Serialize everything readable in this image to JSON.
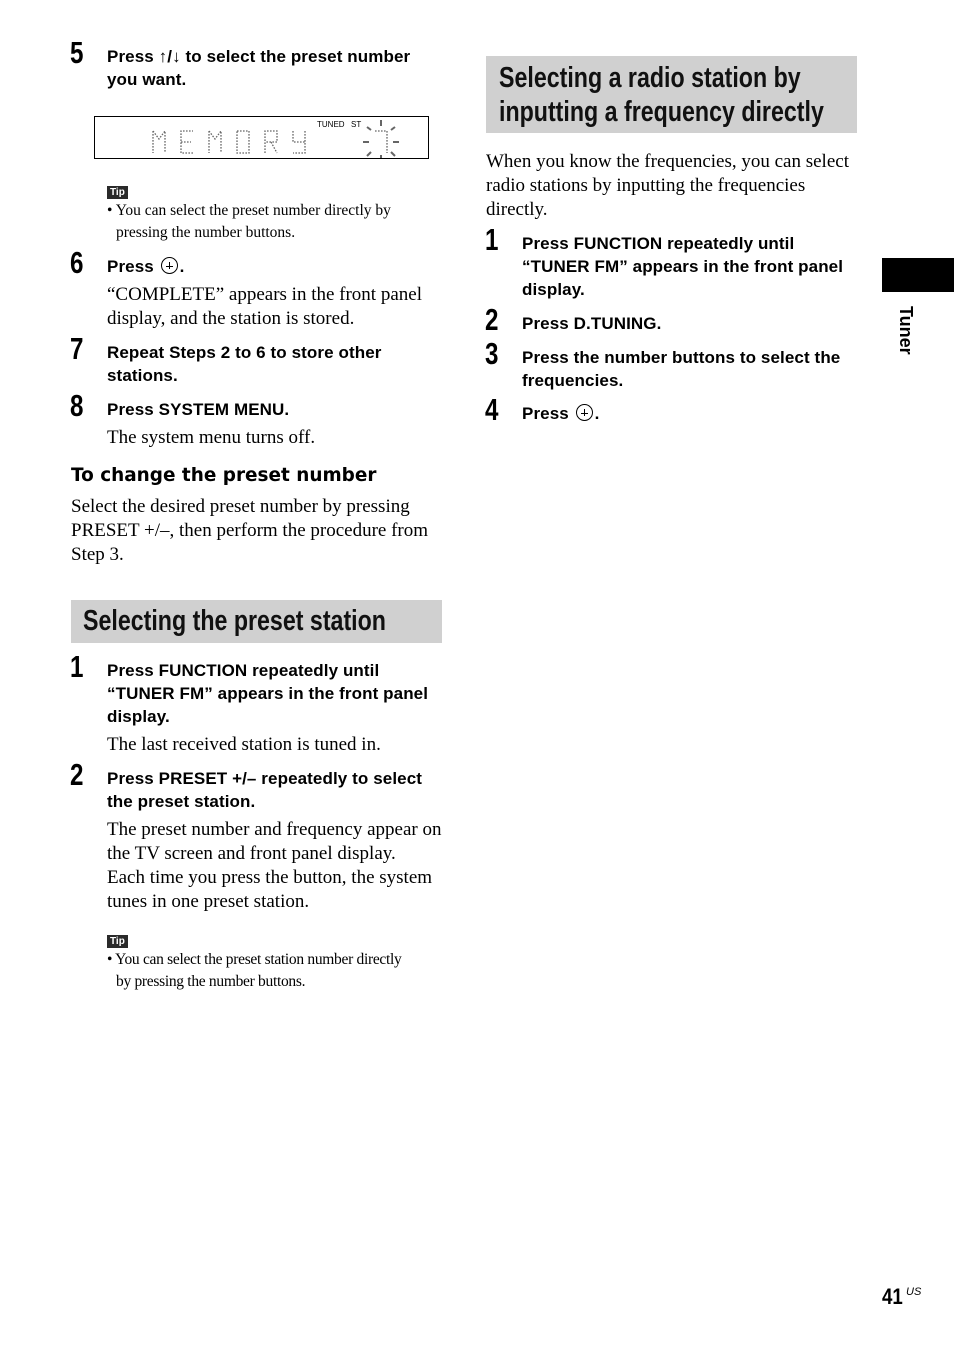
{
  "left_column": {
    "steps_a": [
      {
        "num": "5",
        "heading_pre": "Press ",
        "heading_arrows": "↑/↓",
        "heading_post_1": " to select the preset number",
        "heading_line2": "you want."
      },
      {
        "num": "6",
        "heading_pre": "Press",
        "heading_post": "."
      },
      {
        "num": "7",
        "heading_line1": "Repeat Steps 2 to 6 to store other",
        "heading_line2": "stations."
      },
      {
        "num": "8",
        "heading_line1": "Press SYSTEM MENU."
      }
    ],
    "display": {
      "text": "MEMORY",
      "indicator_tuned": "TUNED",
      "indicator_st": "ST",
      "preset_digit": "7"
    },
    "tip1": {
      "badge": "Tip",
      "line1": "• You can select the preset number directly by",
      "line2": "pressing the number buttons."
    },
    "step6_body": [
      "“COMPLETE” appears in the front panel",
      "display, and the station is stored."
    ],
    "step8_body": "The system menu turns off.",
    "change_preset": {
      "title": "To change the preset number",
      "lines": [
        "Select the desired preset number by pressing",
        "PRESET +/–, then perform the procedure from",
        "Step 3."
      ]
    },
    "section2": {
      "title": "Selecting the preset station",
      "step1": {
        "num": "1",
        "lines": [
          "Press FUNCTION repeatedly until",
          "“TUNER FM” appears in the front panel",
          "display."
        ],
        "body": "The last received station is tuned in."
      },
      "step2": {
        "num": "2",
        "lines": [
          "Press PRESET +/– repeatedly to select",
          "the preset station."
        ],
        "body": [
          "The preset number and frequency appear on",
          "the TV screen and front panel display.",
          "Each time you press the button, the system",
          "tunes in one preset station."
        ]
      },
      "tip": {
        "badge": "Tip",
        "line1": "• You can select the preset station number directly",
        "line2": "by pressing the number buttons."
      }
    }
  },
  "right_column": {
    "section_title": [
      "Selecting a radio station by",
      "inputting a frequency directly"
    ],
    "intro": [
      "When you know the frequencies, you can select",
      "radio stations by inputting the frequencies",
      "directly."
    ],
    "steps": [
      {
        "num": "1",
        "lines": [
          "Press FUNCTION repeatedly until",
          "“TUNER FM” appears in the front panel",
          "display."
        ]
      },
      {
        "num": "2",
        "lines": [
          "Press D.TUNING."
        ]
      },
      {
        "num": "3",
        "lines": [
          "Press the number buttons to select the",
          "frequencies."
        ]
      },
      {
        "num": "4",
        "pre": "Press",
        "post": "."
      }
    ]
  },
  "side_tab": {
    "label": "Tuner"
  },
  "footer": {
    "page_number": "41",
    "region": "US"
  }
}
